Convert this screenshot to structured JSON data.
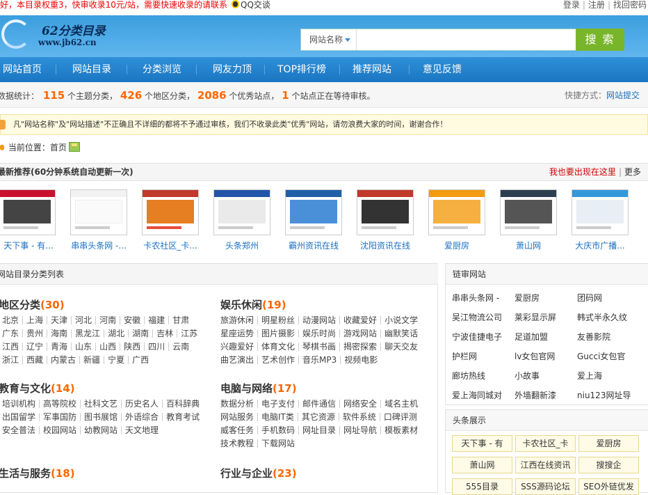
{
  "topbar": {
    "notice": "好，本目录权重3，快审收录10元/站，需要快速收录的请联系",
    "qq_label": "QQ交谈",
    "login": "登录",
    "register": "注册",
    "find_password": "找回密码"
  },
  "header": {
    "logo_name": "62分类目录",
    "logo_url": "www.jb62.cn",
    "search_select": "网站名称",
    "search_value": "",
    "search_button": "搜 索"
  },
  "nav": [
    "网站首页",
    "网站目录",
    "分类浏览",
    "网友力顶",
    "TOP排行榜",
    "推荐网站",
    "意见反馈"
  ],
  "stats": {
    "prefix": "数据统计：",
    "themes": "115",
    "themes_label": "个主题分类，",
    "regions": "426",
    "regions_label": "个地区分类，",
    "sites": "2086",
    "sites_label": "个优秀站点，",
    "pending": "1",
    "pending_label": "个站点正在等待审核。",
    "quick_label": "快捷方式：",
    "quick_link": "网站提交"
  },
  "alert": "凡\"网站名称\"及\"网站描述\"不正确且不详细的都将不予通过审核，我们不收录此类\"优秀\"网站，请勿浪费大家的时间，谢谢合作！",
  "breadcrumb": {
    "label": "当前位置：",
    "home": "首页"
  },
  "recommend": {
    "title": "最新推荐(60分钟系统自动更新一次)",
    "appear": "我也要出现在这里",
    "more": "更多",
    "items": [
      "天下事 - 有...",
      "串串头条网 -...",
      "卡农社区_卡...",
      "头条郑州",
      "霸州资讯在线",
      "沈阳资讯在线",
      "爱厨房",
      "萧山网",
      "大庆市广播..."
    ]
  },
  "categories": {
    "header": "网站目录分类列表",
    "groups": [
      {
        "name": "地区分类",
        "count": "(30)",
        "rows": [
          [
            "北京",
            "上海",
            "天津",
            "河北",
            "河南",
            "安徽",
            "福建",
            "甘肃"
          ],
          [
            "广东",
            "贵州",
            "海南",
            "黑龙江",
            "湖北",
            "湖南",
            "吉林",
            "江苏"
          ],
          [
            "江西",
            "辽宁",
            "青海",
            "山东",
            "山西",
            "陕西",
            "四川",
            "云南"
          ],
          [
            "浙江",
            "西藏",
            "内蒙古",
            "新疆",
            "宁夏",
            "广西"
          ]
        ]
      },
      {
        "name": "娱乐休闲",
        "count": "(19)",
        "rows": [
          [
            "旅游休闲",
            "明星粉丝",
            "动漫网站",
            "收藏爱好",
            "小说文学"
          ],
          [
            "星座运势",
            "图片摄影",
            "娱乐时尚",
            "游戏网站",
            "幽默笑话"
          ],
          [
            "兴趣爱好",
            "体育文化",
            "琴棋书画",
            "揭密探索",
            "聊天交友"
          ],
          [
            "曲艺演出",
            "艺术创作",
            "音乐MP3",
            "视频电影"
          ]
        ]
      },
      {
        "name": "教育与文化",
        "count": "(14)",
        "rows": [
          [
            "培训机构",
            "高等院校",
            "社科文艺",
            "历史名人",
            "百科辞典"
          ],
          [
            "出国留学",
            "军事国防",
            "图书展馆",
            "外语综合",
            "教育考试"
          ],
          [
            "安全普法",
            "校园网站",
            "幼教网站",
            "天文地理"
          ]
        ]
      },
      {
        "name": "电脑与网络",
        "count": "(17)",
        "rows": [
          [
            "数据分析",
            "电子支付",
            "邮件通信",
            "网络安全",
            "域名主机"
          ],
          [
            "网站服务",
            "电脑IT类",
            "其它资源",
            "软件系统",
            "口碑评测"
          ],
          [
            "威客任务",
            "手机数码",
            "网址目录",
            "网址导航",
            "模板素材"
          ],
          [
            "技术教程",
            "下载网站"
          ]
        ]
      },
      {
        "name": "生活与服务",
        "count": "(18)",
        "rows": []
      },
      {
        "name": "行业与企业",
        "count": "(23)",
        "rows": []
      }
    ]
  },
  "friend_links": {
    "title": "链审网站",
    "items": [
      "串串头条网 -",
      "爱厨房",
      "团码网",
      "吴江物流公司",
      "莱彩显示屏",
      "韩式半永久纹",
      "宁波佳捷电子",
      "足道加盟",
      "友善影院",
      "护栏网",
      "lv女包官网",
      "Gucci女包官",
      "廊坊热线",
      "小故事",
      "爱上海",
      "爱上海同城对",
      "外墙翻新漆",
      "niu123网址导"
    ]
  },
  "headlines": {
    "title": "头条展示",
    "items": [
      "天下事 - 有",
      "卡农社区_卡",
      "爱厨房",
      "萧山网",
      "江西在线资讯",
      "搜搜企",
      "555目录",
      "SSS源码论坛",
      "SEO外链优发"
    ]
  },
  "colors": {
    "accent": "#f60",
    "link": "#1a6fc0",
    "nav": "#1a76c2",
    "search_btn": "#79b52a"
  }
}
